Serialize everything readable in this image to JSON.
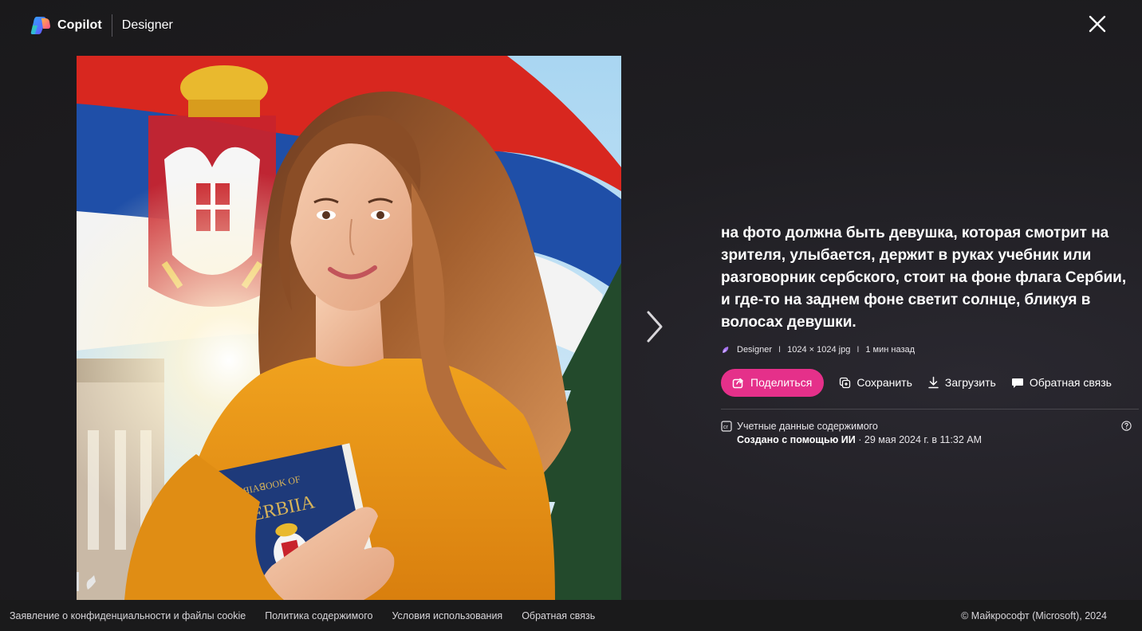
{
  "header": {
    "brand_name": "Copilot",
    "product_name": "Designer"
  },
  "image": {
    "book_line1": "ꟼЯIAꓭOOK OF",
    "book_line2": "SERBIIA"
  },
  "details": {
    "prompt": "на фото должна быть девушка, которая смотрит на зрителя, улыбается, держит в руках учебник или разговорник сербского, стоит на фоне флага Сербии, и где-то на заднем фоне светит солнце, бликуя в волосах девушки.",
    "meta": {
      "source": "Designer",
      "dimensions": "1024 × 1024 jpg",
      "time": "1 мин назад",
      "separator": "I"
    },
    "actions": {
      "share": "Поделиться",
      "save": "Сохранить",
      "download": "Загрузить",
      "feedback": "Обратная связь"
    },
    "credentials": {
      "title": "Учетные данные содержимого",
      "created": "Создано с помощью ИИ",
      "dot": "·",
      "date": "29 мая 2024 г. в 11:32 AM"
    }
  },
  "footer": {
    "links": [
      "Заявление о конфиденциальности и файлы cookie",
      "Политика содержимого",
      "Условия использования",
      "Обратная связь"
    ],
    "copyright": "© Майкрософт (Microsoft), 2024"
  },
  "colors": {
    "accent": "#e5308a",
    "background": "#1c1b1d"
  }
}
